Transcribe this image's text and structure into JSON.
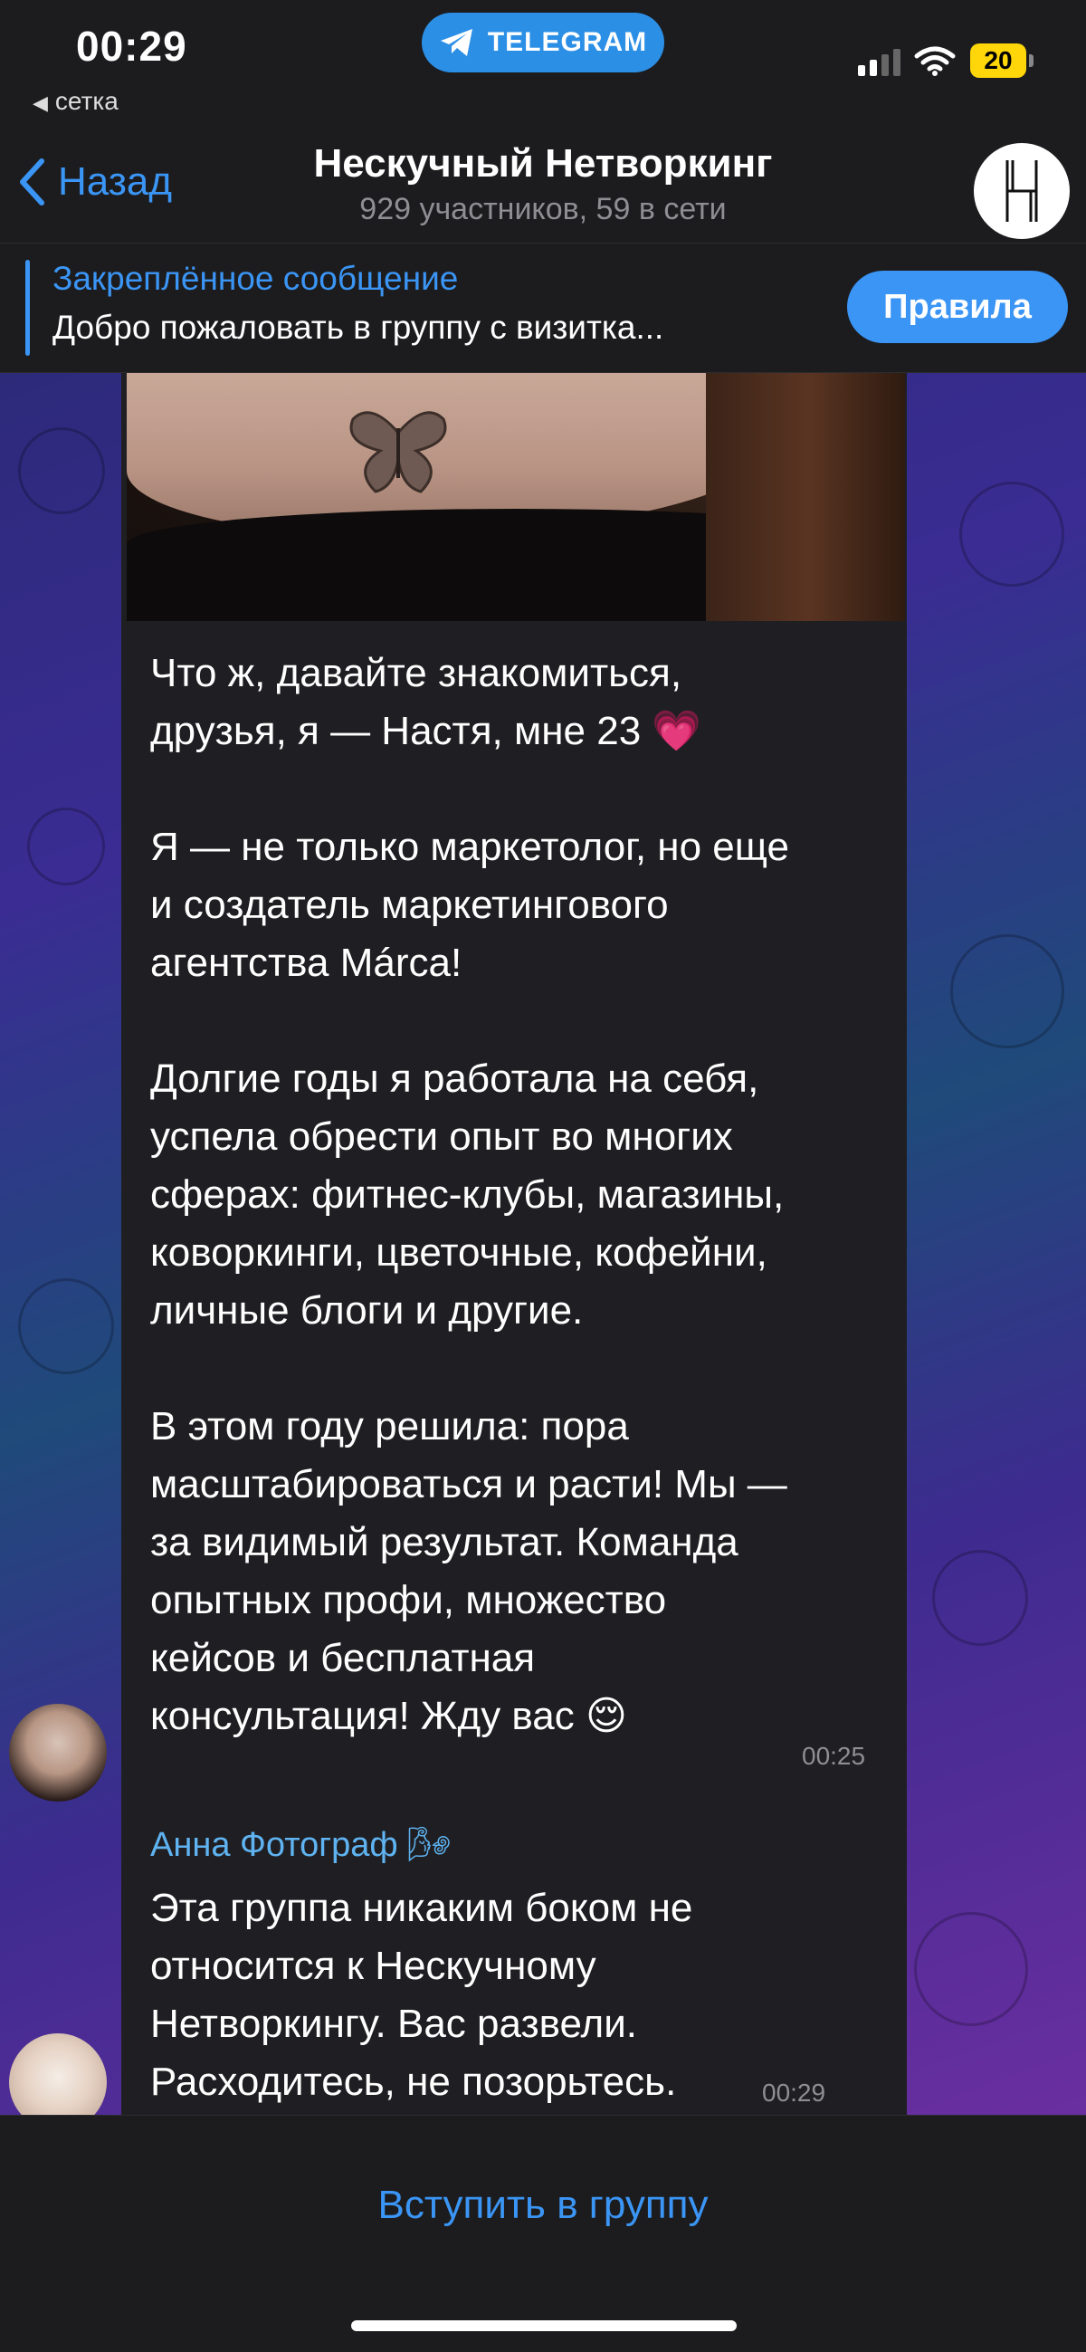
{
  "status_bar": {
    "time": "00:29",
    "back_app": "сетка",
    "telegram_pill": "TELEGRAM",
    "battery": "20"
  },
  "nav": {
    "back_label": "Назад",
    "title": "Нескучный Нетворкинг",
    "subtitle": "929 участников, 59 в сети"
  },
  "pinned": {
    "title": "Закреплённое сообщение",
    "text": "Добро пожаловать в группу с визитка...",
    "button": "Правила"
  },
  "messages": [
    {
      "text": "Что ж, давайте знакомиться,\nдрузья, я — Настя, мне 23 💗\n\nЯ — не только маркетолог, но еще\nи создатель маркетингового\nагентства Márca!\n\nДолгие годы я работала на себя,\nуспела обрести опыт во многих\nсферах: фитнес-клубы, магазины,\nковоркинги, цветочные, кофейни,\nличные блоги и другие.\n\nВ этом году решила: пора\nмасштабироваться и расти! Мы —\nза видимый результат. Команда\nопытных профи, множество\nкейсов и бесплатная\nконсультация! Жду вас 😌",
      "time": "00:25"
    },
    {
      "sender": "Анна Фотограф 🌬",
      "text": "Эта группа никаким боком не\nотносится к Нескучному\nНетворкингу. Вас развели.\nРасходитесь, не позорьтесь.",
      "time": "00:29"
    }
  ],
  "bottom": {
    "join_label": "Вступить в группу"
  },
  "colors": {
    "accent": "#3b95f5",
    "bar_bg": "#1c1c1e",
    "bubble_bg": "#1f1f23",
    "sender_name": "#5fb3f0",
    "battery": "#ffd60a"
  }
}
